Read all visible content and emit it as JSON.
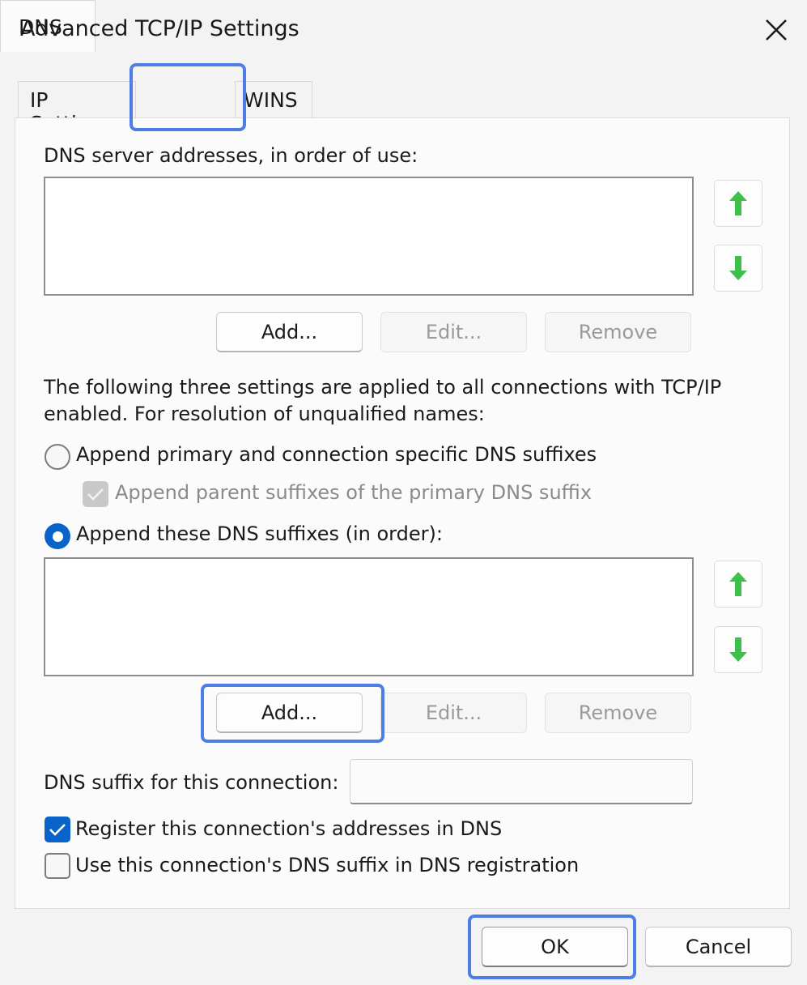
{
  "window": {
    "title": "Advanced TCP/IP Settings"
  },
  "tabs": {
    "ip_settings": "IP Settings",
    "dns": "DNS",
    "wins": "WINS"
  },
  "dns_servers": {
    "label": "DNS server addresses, in order of use:",
    "add": "Add...",
    "edit": "Edit...",
    "remove": "Remove"
  },
  "settings_note": {
    "line1": "The following three settings are applied to all connections with TCP/IP",
    "line2": "enabled. For resolution of unqualified names:"
  },
  "options": {
    "append_primary": "Append primary and connection specific DNS suffixes",
    "append_parent": "Append parent suffixes of the primary DNS suffix",
    "append_these": "Append these DNS suffixes (in order):"
  },
  "suffixes": {
    "add": "Add...",
    "edit": "Edit...",
    "remove": "Remove"
  },
  "connection_suffix": {
    "label": "DNS suffix for this connection:",
    "value": ""
  },
  "registration": {
    "register": "Register this connection's addresses in DNS",
    "use_suffix": "Use this connection's DNS suffix in DNS registration"
  },
  "footer": {
    "ok": "OK",
    "cancel": "Cancel"
  },
  "colors": {
    "accent": "#0a63c9",
    "arrow": "#3cc04a",
    "highlight": "#4d7ee8"
  }
}
